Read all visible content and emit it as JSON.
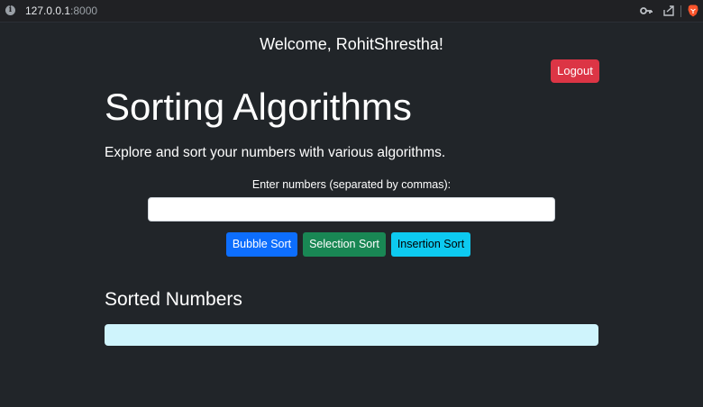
{
  "browser": {
    "url_host": "127.0.0.1",
    "url_port": ":8000",
    "icons": [
      "info-icon",
      "key-icon",
      "share-icon",
      "brave-lion-icon"
    ]
  },
  "header": {
    "welcome_text": "Welcome, RohitShrestha!",
    "logout_label": "Logout"
  },
  "main": {
    "title": "Sorting Algorithms",
    "subtitle": "Explore and sort your numbers with various algorithms.",
    "input_label": "Enter numbers (separated by commas):",
    "input_value": "",
    "buttons": {
      "bubble": "Bubble Sort",
      "selection": "Selection Sort",
      "insertion": "Insertion Sort"
    },
    "sorted_heading": "Sorted Numbers",
    "sorted_output": ""
  },
  "colors": {
    "background": "#212529",
    "logout": "#dc3545",
    "bubble": "#0d6efd",
    "selection": "#198754",
    "insertion": "#0dcaf0",
    "sorted_box": "#cff4fc"
  }
}
